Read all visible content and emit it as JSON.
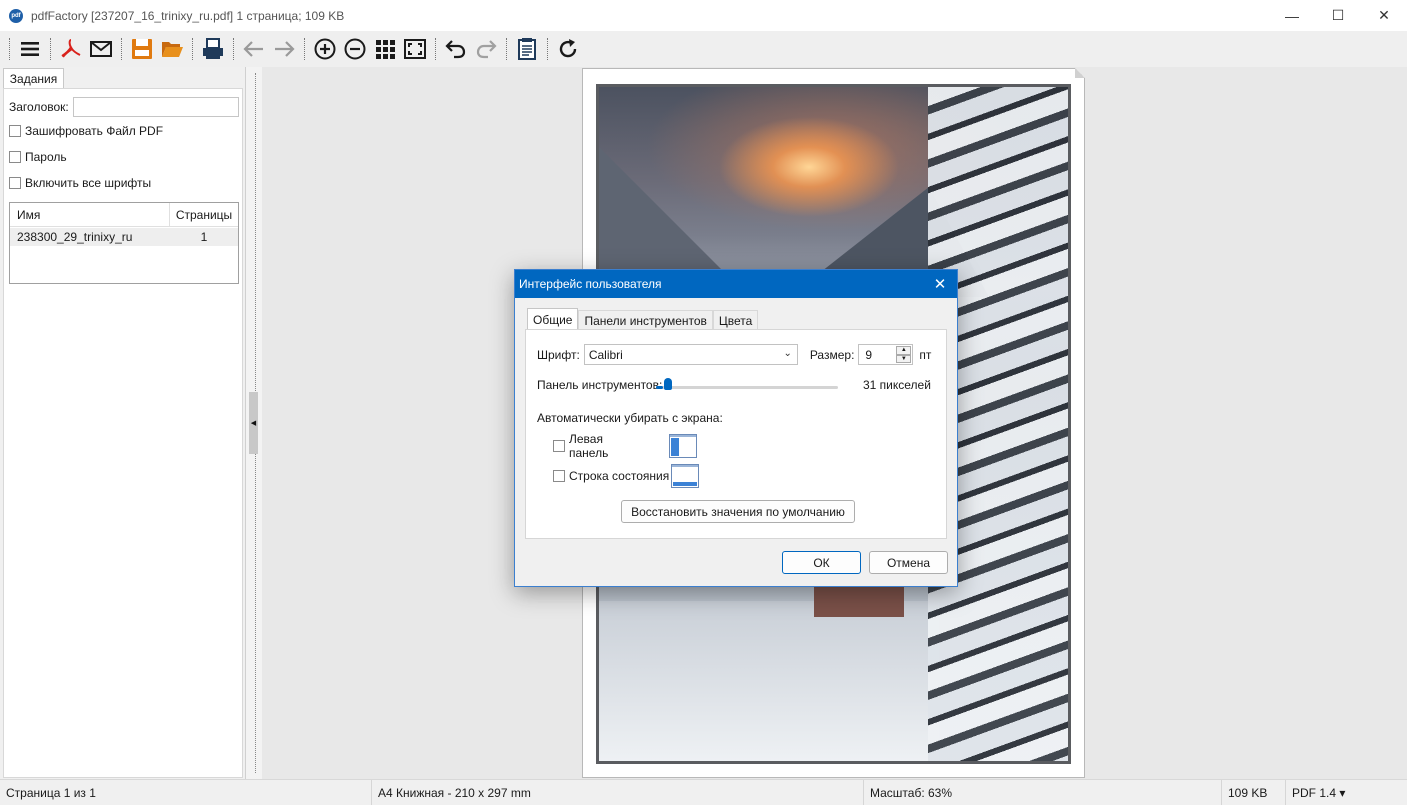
{
  "window": {
    "title": "pdfFactory [237207_16_trinixy_ru.pdf] 1 страница; 109 KB",
    "app_icon_text": "pdf",
    "controls": {
      "minimize": "—",
      "maximize": "☐",
      "close": "✕"
    }
  },
  "toolbar": {
    "icons": [
      "menu-icon",
      "pdf-icon",
      "email-icon",
      "save-icon",
      "open-folder-icon",
      "print-icon",
      "back-arrow-icon",
      "forward-arrow-icon",
      "zoom-in-icon",
      "zoom-out-icon",
      "thumbnails-icon",
      "fit-page-icon",
      "undo-icon",
      "redo-icon",
      "properties-icon",
      "refresh-icon"
    ]
  },
  "left_panel": {
    "tab": "Задания",
    "title_label": "Заголовок:",
    "title_value": "",
    "encrypt_label": "Зашифровать Файл PDF",
    "password_label": "Пароль",
    "embed_fonts_label": "Включить все шрифты",
    "files": {
      "columns": [
        "Имя",
        "Страницы"
      ],
      "rows": [
        {
          "name": "238300_29_trinixy_ru",
          "pages": "1"
        }
      ]
    }
  },
  "dialog": {
    "title": "Интерфейс пользователя",
    "tabs": [
      "Общие",
      "Панели инструментов",
      "Цвета"
    ],
    "active_tab": "Общие",
    "font_label": "Шрифт:",
    "font_value": "Calibri",
    "size_label": "Размер:",
    "size_value": "9",
    "size_unit": "пт",
    "toolbar_size_label": "Панель инструментов:",
    "toolbar_size_value": "31 пикселей",
    "auto_hide_label": "Автоматически убирать с экрана:",
    "left_panel_label": "Левая панель",
    "status_bar_label": "Строка состояния",
    "restore_button": "Восстановить значения по умолчанию",
    "ok_button": "ОК",
    "cancel_button": "Отмена"
  },
  "statusbar": {
    "page_info": "Страница 1 из 1",
    "paper": "A4 Книжная - 210 x 297 mm",
    "zoom": "Масштаб: 63%",
    "size": "109 KB",
    "pdf_version": "PDF 1.4 ▾"
  },
  "colors": {
    "accent": "#0067c0",
    "pdf_red": "#d9221c",
    "save_orange": "#e07a10",
    "folder_orange": "#e8901c",
    "toolbar_blue": "#1f3a5a"
  }
}
